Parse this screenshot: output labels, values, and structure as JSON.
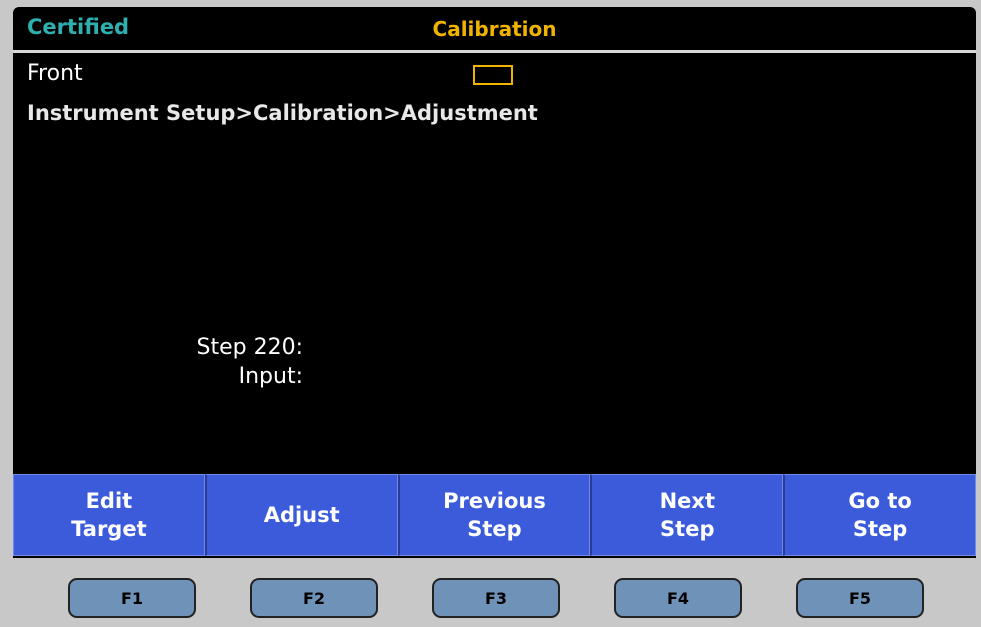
{
  "header": {
    "status": "Certified",
    "title": "Calibration",
    "accent_color": "#f0b400",
    "status_color": "#2fb0b0"
  },
  "content": {
    "terminal": "Front",
    "breadcrumb": "Instrument Setup>Calibration>Adjustment",
    "step_label": "Step 220:",
    "input_label": "Input:"
  },
  "softkeys": [
    {
      "label": "Edit\nTarget"
    },
    {
      "label": "Adjust"
    },
    {
      "label": "Previous\nStep"
    },
    {
      "label": "Next\nStep"
    },
    {
      "label": "Go to\nStep"
    }
  ],
  "fkeys": [
    "F1",
    "F2",
    "F3",
    "F4",
    "F5"
  ],
  "colors": {
    "softkey_bg": "#3b5bdb",
    "fkey_bg": "#6f93b8",
    "screen_bg": "#000000",
    "bezel_bg": "#c8c8c8"
  }
}
